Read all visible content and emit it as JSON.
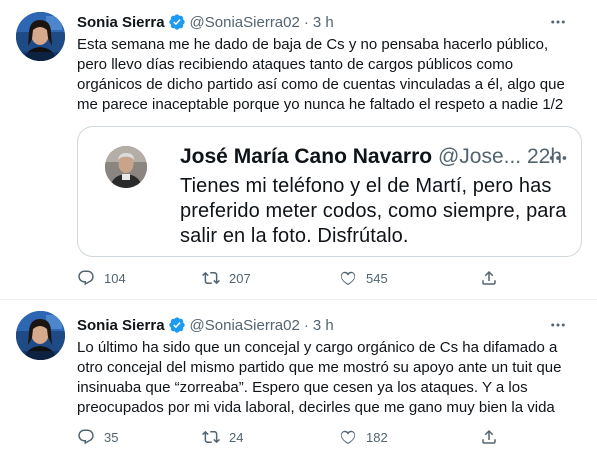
{
  "tweets": [
    {
      "author_name": "Sonia Sierra",
      "handle": "@SoniaSierra02",
      "separator": "·",
      "time": "3 h",
      "text": "Esta semana me he dado de baja de Cs y no pensaba hacerlo público, pero llevo días recibiendo ataques tanto de cargos públicos como orgánicos de dicho partido así como de cuentas vinculadas a él, algo que me parece inaceptable porque yo nunca he faltado el respeto a nadie 1/2",
      "quote": {
        "author_name": "José María Cano Navarro",
        "handle": "@Jose...",
        "time": "22h",
        "text": "Tienes mi teléfono y el de Martí, pero has preferido meter codos, como siempre, para salir en la foto. Disfrútalo."
      },
      "replies": "104",
      "retweets": "207",
      "likes": "545"
    },
    {
      "author_name": "Sonia Sierra",
      "handle": "@SoniaSierra02",
      "separator": "·",
      "time": "3 h",
      "text": "Lo último ha sido que un concejal y cargo orgánico de Cs ha difamado a otro concejal del mismo partido que me mostró su apoyo ante un tuit que insinuaba que “zorreaba”. Espero que cesen ya los ataques. Y a los preocupados por mi vida laboral, decirles que me gano muy bien la vida",
      "replies": "35",
      "retweets": "24",
      "likes": "182"
    }
  ],
  "colors": {
    "text": "#0f1419",
    "secondary": "#536471",
    "verified": "#1d9bf0",
    "border": "#cfd9de"
  },
  "icons": [
    "verified-badge-icon",
    "more-icon",
    "reply-icon",
    "retweet-icon",
    "like-icon",
    "share-icon"
  ]
}
